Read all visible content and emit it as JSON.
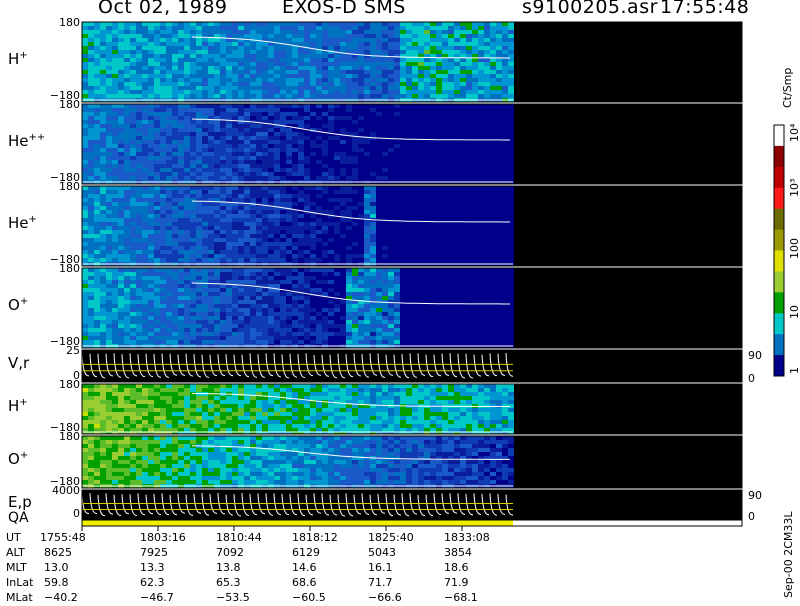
{
  "header": {
    "date": "Oct 02, 1989",
    "mission": "EXOS-D SMS",
    "file": "s9100205.asr",
    "time": "17:55:48"
  },
  "colorbar": {
    "unit": "Ct/Smp",
    "ticks": [
      "10⁴",
      "10³",
      "100",
      "10",
      "1"
    ],
    "colors": [
      "#ffffff",
      "#8b0000",
      "#c00000",
      "#ff1a1a",
      "#6b6b00",
      "#9a9a00",
      "#e0e000",
      "#9acd32",
      "#00a000",
      "#00c8c8",
      "#0070c0",
      "#00008b"
    ]
  },
  "panels": [
    {
      "label": "H",
      "sup": "+",
      "ymax": "180",
      "ymin": "−180"
    },
    {
      "label": "He",
      "sup": "++",
      "ymax": "180",
      "ymin": "−180"
    },
    {
      "label": "He",
      "sup": "+",
      "ymax": "180",
      "ymin": "−180"
    },
    {
      "label": "O",
      "sup": "+",
      "ymax": "180",
      "ymin": "−180"
    },
    {
      "label": "V,r",
      "sup": "",
      "ymax": "25",
      "ymin": "0",
      "rmax": "90",
      "rmin": "0"
    },
    {
      "label": "H",
      "sup": "+",
      "ymax": "180",
      "ymin": "−180"
    },
    {
      "label": "O",
      "sup": "+",
      "ymax": "180",
      "ymin": "−180"
    },
    {
      "label": "E,p",
      "sup": "",
      "ymax": "4000",
      "ymin": "0",
      "rmax": "90",
      "rmin": "0"
    }
  ],
  "qa_label": "QA",
  "dataset_id": "Sep-00 2CM33L",
  "ephemeris": {
    "rows": [
      {
        "name": "UT",
        "values": [
          "1755:48",
          "1803:16",
          "1810:44",
          "1818:12",
          "1825:40",
          "1833:08"
        ]
      },
      {
        "name": "ALT",
        "values": [
          "8625",
          "7925",
          "7092",
          "6129",
          "5043",
          "3854"
        ]
      },
      {
        "name": "MLT",
        "values": [
          "13.0",
          "13.3",
          "13.8",
          "14.6",
          "16.1",
          "18.6"
        ]
      },
      {
        "name": "InLat",
        "values": [
          "59.8",
          "62.3",
          "65.3",
          "68.6",
          "71.7",
          "71.9"
        ]
      },
      {
        "name": "MLat",
        "values": [
          "−40.2",
          "−46.7",
          "−53.5",
          "−60.5",
          "−66.6",
          "−68.1"
        ]
      }
    ]
  }
}
